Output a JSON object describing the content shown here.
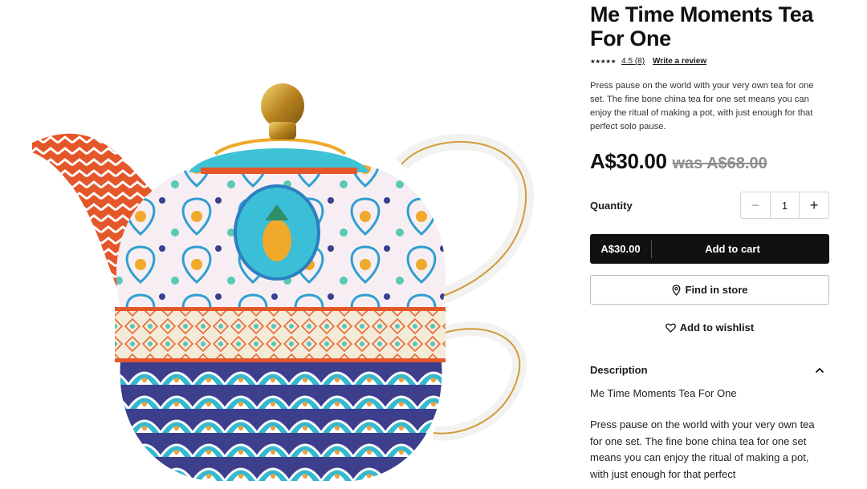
{
  "product": {
    "title": "Me Time Moments Tea For One",
    "rating_value": "4.5",
    "rating_count": "(8)",
    "rating_stars": "★★★★★",
    "write_review": "Write a review",
    "blurb": "Press pause on the world with your very own tea for one set. The fine bone china tea for one set means you can enjoy the ritual of making a pot, with just enough for that perfect solo pause.",
    "price_now": "A$30.00",
    "price_was": "was A$68.00"
  },
  "purchase": {
    "quantity_label": "Quantity",
    "minus": "−",
    "quantity_value": "1",
    "plus": "+",
    "cart_price": "A$30.00",
    "cart_label": "Add to cart",
    "find_in_store": "Find in store",
    "wishlist": "Add to wishlist"
  },
  "description": {
    "heading": "Description",
    "subtitle": "Me Time Moments Tea For One",
    "body": "Press pause on the world with your very own tea for one set. The fine bone china tea for one set means you can enjoy the ritual of making a pot, with just enough for that perfect"
  },
  "icons": {
    "pin": "map-pin-icon",
    "heart": "heart-icon",
    "chevron": "chevron-up-icon"
  },
  "colors": {
    "button_dark": "#111111",
    "turquoise": "#3bbfd6",
    "orange": "#e0592a",
    "gold": "#c9962e",
    "navy": "#3b3f8f"
  }
}
